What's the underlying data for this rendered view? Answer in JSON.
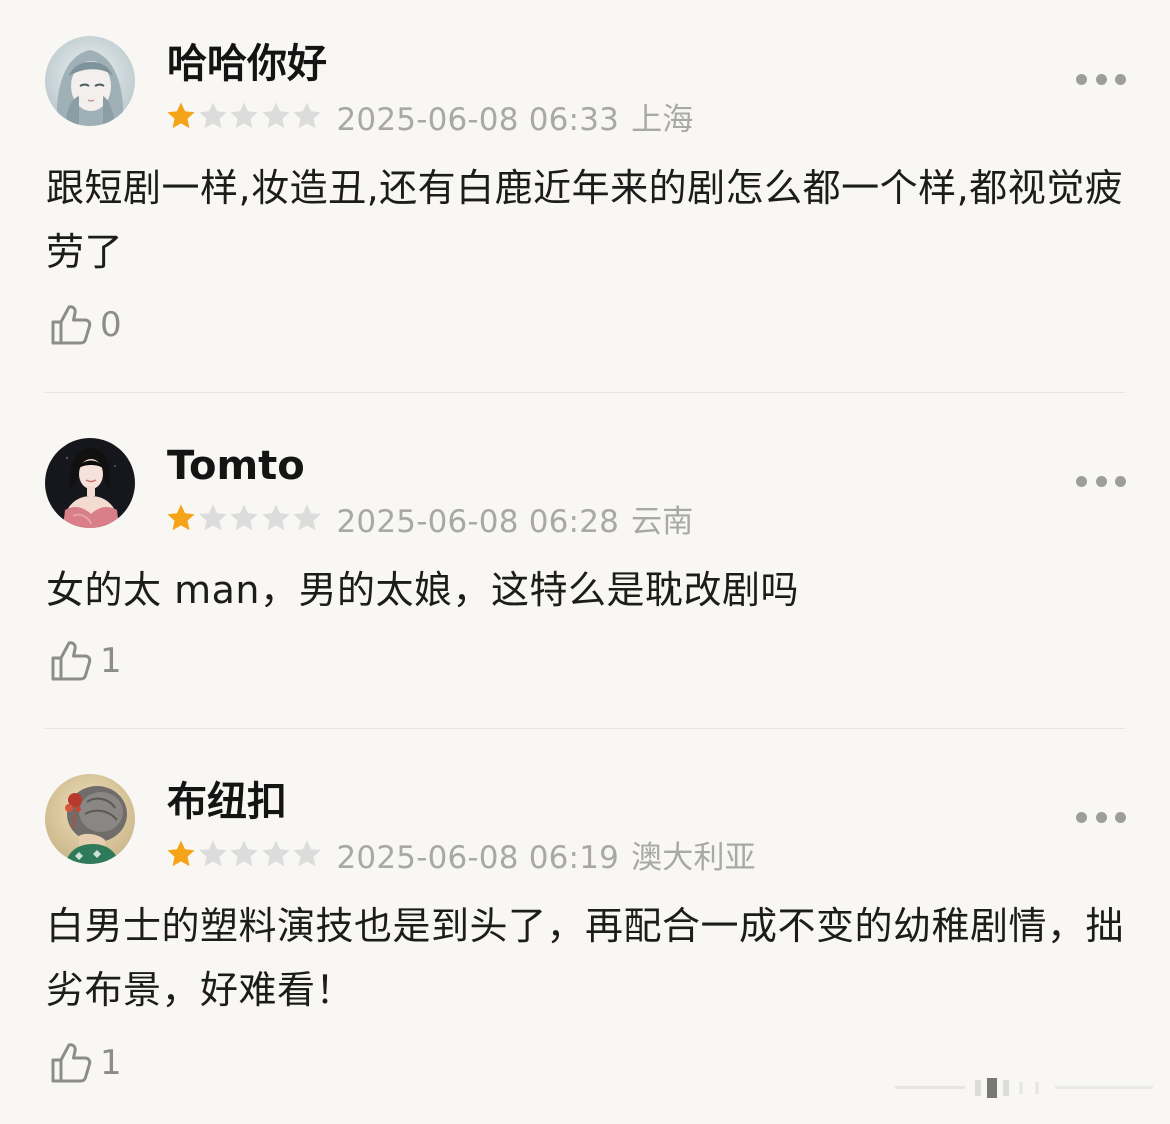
{
  "reviews": [
    {
      "username": "哈哈你好",
      "rating": 1,
      "max_rating": 5,
      "timestamp": "2025-06-08 06:33",
      "location": "上海",
      "content": "跟短剧一样,妆造丑,还有白鹿近年来的剧怎么都一个样,都视觉疲劳了",
      "likes": "0",
      "avatar_icon": "anime-girl-avatar"
    },
    {
      "username": "Tomto",
      "rating": 1,
      "max_rating": 5,
      "timestamp": "2025-06-08 06:28",
      "location": "云南",
      "content": "女的太 man，男的太娘，这特么是耽改剧吗",
      "likes": "1",
      "avatar_icon": "woman-portrait-avatar"
    },
    {
      "username": "布纽扣",
      "rating": 1,
      "max_rating": 5,
      "timestamp": "2025-06-08 06:19",
      "location": "澳大利亚",
      "content": "白男士的塑料演技也是到头了，再配合一成不变的幼稚剧情，拙劣布景，好难看！",
      "likes": "1",
      "avatar_icon": "hair-bun-avatar"
    }
  ],
  "colors": {
    "background": "#f8f7f3",
    "star_filled": "#f5a419",
    "star_empty": "#dcdcdc",
    "meta_text": "#a8a8a8",
    "divider": "#e4e3df"
  }
}
